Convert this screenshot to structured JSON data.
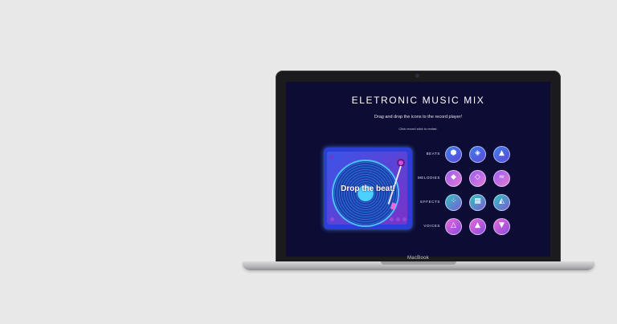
{
  "device": {
    "brand": "MacBook"
  },
  "app": {
    "title": "ELETRONIC MUSIC MIX",
    "instruction": "Drag and drop the icons to the record player!",
    "hint": "Click record stick to restart.",
    "player_text": "Drop the beat!"
  },
  "categories": [
    {
      "label": "BEATS",
      "colors": [
        "#3f7de8",
        "#5a49d8"
      ],
      "icons": [
        "hexagon-grid-icon",
        "cube-icon",
        "mountain-icon"
      ]
    },
    {
      "label": "MELODIES",
      "colors": [
        "#9c5ef0",
        "#e07bd6"
      ],
      "icons": [
        "diamond-lines-icon",
        "diamond-nested-icon",
        "wave-lines-icon"
      ]
    },
    {
      "label": "EFFECTS",
      "colors": [
        "#2cc3c0",
        "#7f5ad6"
      ],
      "icons": [
        "dot-cluster-icon",
        "grid-square-icon",
        "triangle-spiral-icon"
      ]
    },
    {
      "label": "VOICES",
      "colors": [
        "#e56bd6",
        "#8a4ae0"
      ],
      "icons": [
        "triangle-icon",
        "triangle-stack-icon",
        "triangle-dots-icon"
      ]
    }
  ]
}
